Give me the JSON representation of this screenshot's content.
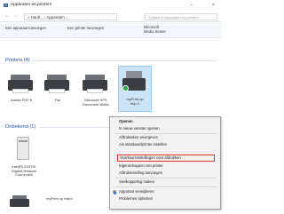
{
  "window": {
    "title": "Apparaten en printers",
    "minimize": "–",
    "close": "×"
  },
  "address": {
    "back": "←",
    "forward": "→",
    "path": "« Hardl... › Apparaten ...",
    "search_placeholder": "Zoeken in apparaten en printers"
  },
  "toolbar": {
    "add_device": "Een apparaat toevoegen",
    "add_printer": "Een printer toevoegen",
    "media_server": "Microsoft\nMedia Server"
  },
  "sections": {
    "printers": "Printers (4)",
    "unspecified": "Onbekend (1)"
  },
  "printers": [
    {
      "label": "Adobe PDF 6"
    },
    {
      "label": "Fax"
    },
    {
      "label": "Microsoft XPS\nDocument Writer"
    },
    {
      "label": "myPrint op\nhttp://"
    }
  ],
  "unspecified_devices": [
    {
      "label": "Intel(R) 82579L\nGigabit Network\nConnection"
    },
    {
      "label": "myPrint op http://"
    }
  ],
  "context_menu": {
    "items": [
      {
        "label": "Openen",
        "bold": true
      },
      {
        "label": "In nieuw venster openen"
      },
      {
        "label": "Afdruktaken weergeven"
      },
      {
        "label": "Als standaardprinter instellen"
      },
      {
        "label": "Voorkeursinstellingen voor afdrukken",
        "highlighted": true
      },
      {
        "label": "Eigenschappen van printer"
      },
      {
        "label": "Afdrukinstelling toevoegen"
      },
      {
        "label": "Snelkoppeling maken"
      },
      {
        "label": "Apparaat verwijderen"
      },
      {
        "label": "Problemen oplossen"
      }
    ]
  },
  "colors": {
    "accent": "#1e4e9c",
    "selection": "#cce4f7",
    "highlight_border": "#e0312b",
    "status_ok": "#2aa745"
  }
}
